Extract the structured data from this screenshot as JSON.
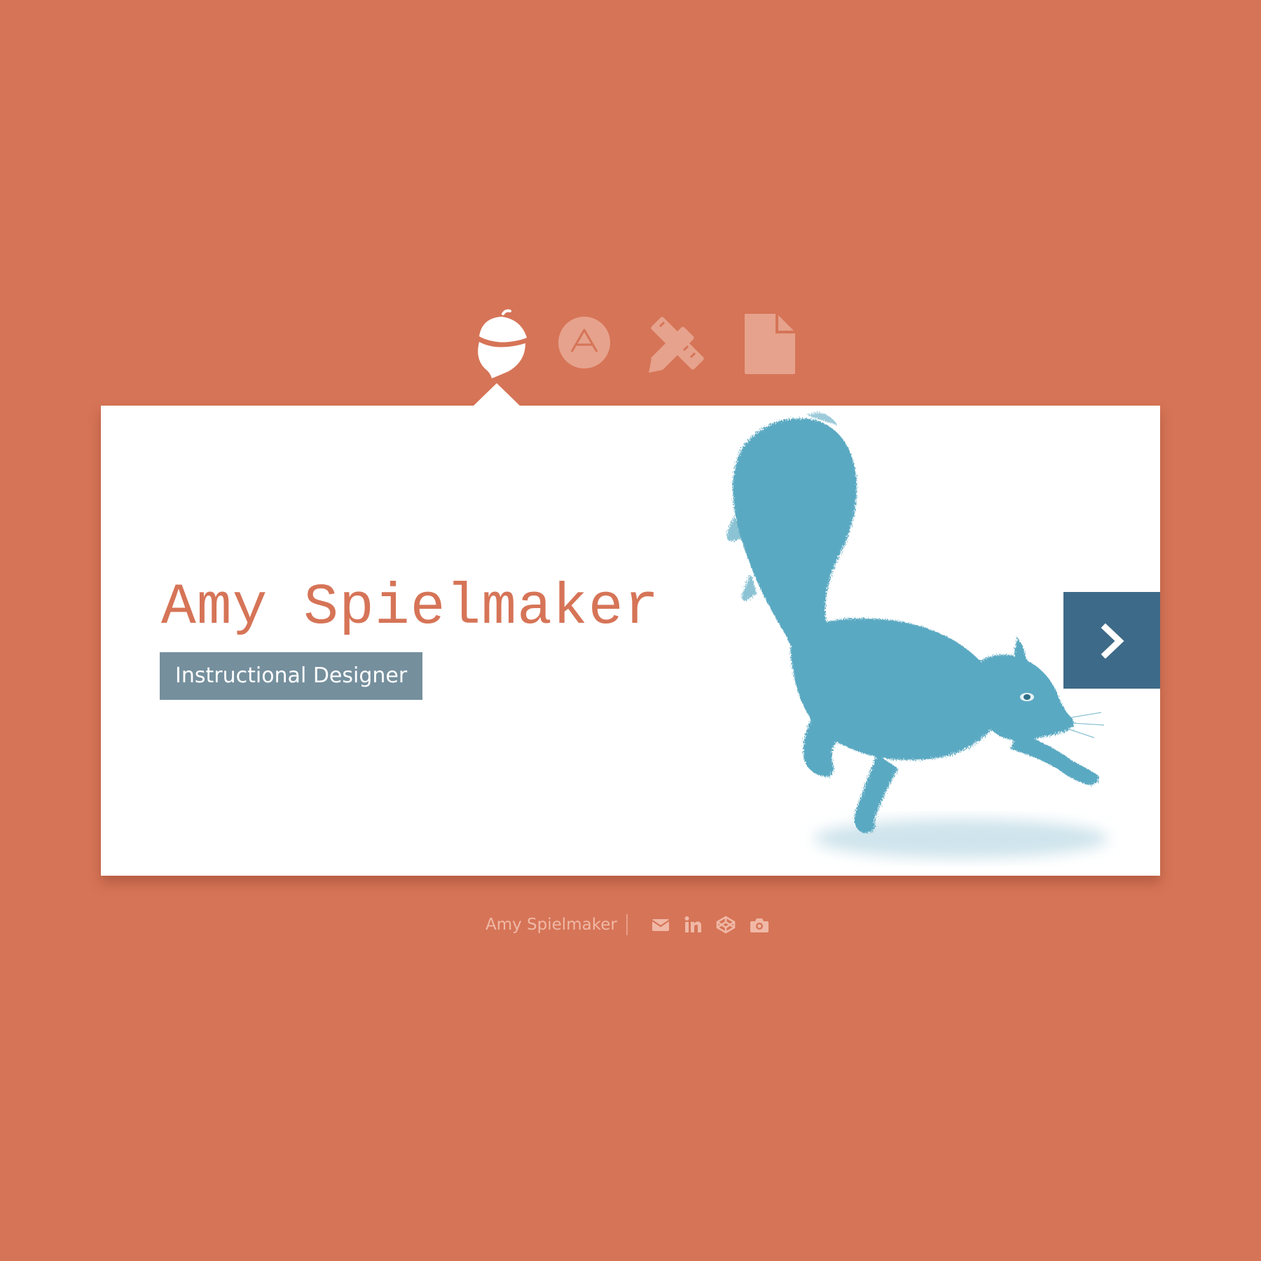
{
  "colors": {
    "background": "#d67457",
    "card": "#ffffff",
    "accent": "#d67457",
    "badge": "#758f9d",
    "next_button": "#3d6a88",
    "illustration": "#5aa9c2",
    "inactive_icon": "#e6a28c",
    "footer_text": "#f0b8a6"
  },
  "nav": {
    "items": [
      {
        "icon": "acorn-icon",
        "active": true
      },
      {
        "icon": "a-circle-icon",
        "active": false
      },
      {
        "icon": "pencil-ruler-icon",
        "active": false
      },
      {
        "icon": "document-icon",
        "active": false
      }
    ]
  },
  "hero": {
    "name": "Amy Spielmaker",
    "role": "Instructional Designer",
    "illustration": "squirrel-illustration",
    "next_icon": "chevron-right-icon"
  },
  "footer": {
    "name": "Amy Spielmaker",
    "social": [
      {
        "icon": "email-icon"
      },
      {
        "icon": "linkedin-icon"
      },
      {
        "icon": "codepen-icon"
      },
      {
        "icon": "camera-icon"
      }
    ]
  }
}
